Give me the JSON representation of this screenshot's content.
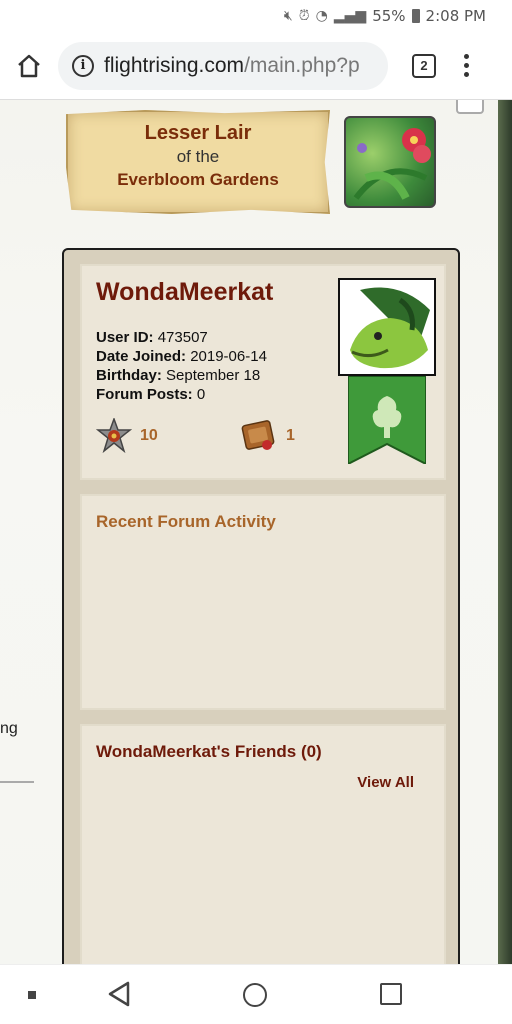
{
  "status_bar": {
    "battery": "55%",
    "time": "2:08 PM"
  },
  "browser": {
    "url_domain": "flightrising.com",
    "url_path": "/main.php?p",
    "tab_count": "2"
  },
  "side": {
    "partial_text": "ng"
  },
  "lair": {
    "line1": "Lesser Lair",
    "line2": "of the",
    "line3": "Everbloom Gardens"
  },
  "profile": {
    "username": "WondaMeerkat",
    "user_id_label": "User ID:",
    "user_id": "473507",
    "date_joined_label": "Date Joined:",
    "date_joined": "2019-06-14",
    "birthday_label": "Birthday:",
    "birthday": "September 18",
    "forum_posts_label": "Forum Posts:",
    "forum_posts": "0",
    "star_count": "10",
    "book_count": "1"
  },
  "activity": {
    "title": "Recent Forum Activity"
  },
  "friends": {
    "title": "WondaMeerkat's Friends (0)",
    "view_all": "View All"
  },
  "colors": {
    "title_dark": "#6e1a0a",
    "title_light": "#a8652a",
    "panel_bg": "#d8d0bd",
    "card_bg": "#ece6d8"
  }
}
